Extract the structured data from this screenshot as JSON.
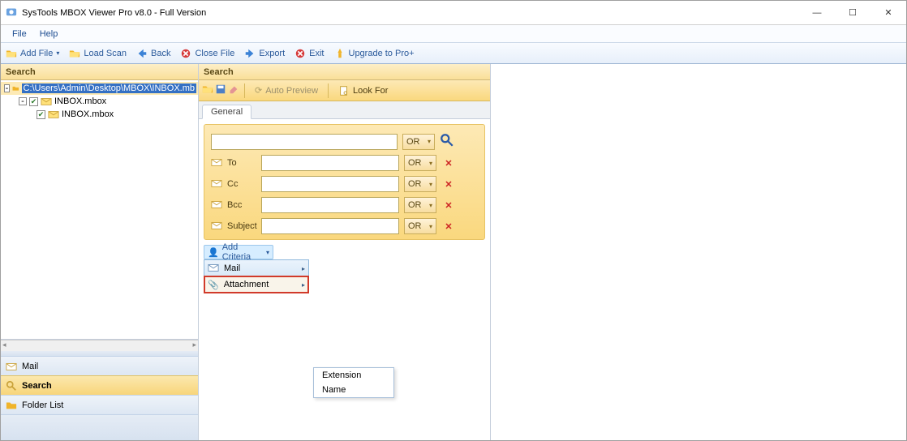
{
  "window": {
    "title": "SysTools MBOX Viewer Pro v8.0 - Full Version"
  },
  "menubar": {
    "file": "File",
    "help": "Help"
  },
  "toolbar": {
    "addfile": "Add File",
    "loadscan": "Load Scan",
    "back": "Back",
    "closefile": "Close File",
    "export": "Export",
    "exit": "Exit",
    "upgrade": "Upgrade to Pro+"
  },
  "leftpanel": {
    "title": "Search",
    "rootpath": "C:\\Users\\Admin\\Desktop\\MBOX\\INBOX.mb",
    "node1": "INBOX.mbox",
    "node2": "INBOX.mbox",
    "nav": {
      "mail": "Mail",
      "search": "Search",
      "folderlist": "Folder List"
    }
  },
  "searchpanel": {
    "title": "Search",
    "autopreview": "Auto Preview",
    "lookfor": "Look For",
    "tab_general": "General",
    "op": "OR",
    "labels": {
      "to": "To",
      "cc": "Cc",
      "bcc": "Bcc",
      "subject": "Subject"
    },
    "addcriteria": "Add Criteria",
    "menu": {
      "mail": "Mail",
      "attachment": "Attachment"
    },
    "submenu": {
      "extension": "Extension",
      "name": "Name"
    }
  }
}
